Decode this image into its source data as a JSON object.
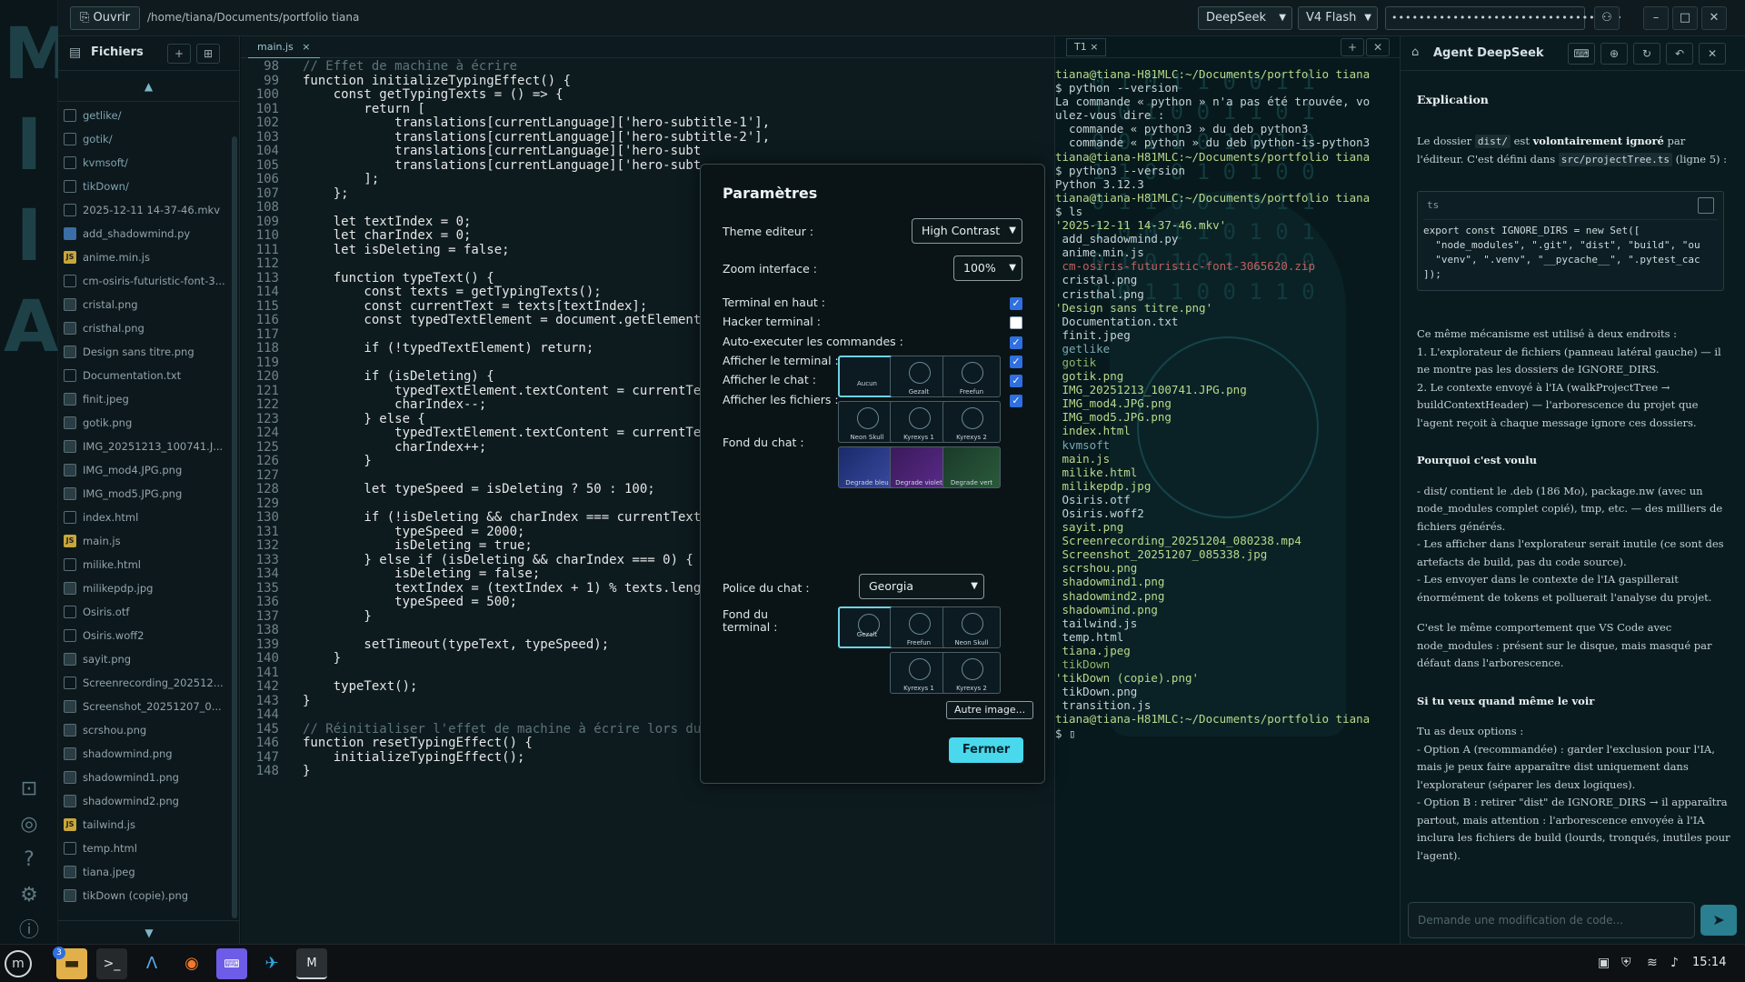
{
  "rail": {
    "letters": [
      "M",
      "I",
      "I",
      "A"
    ]
  },
  "topbar": {
    "open_label": "Ouvrir",
    "path": "/home/tiana/Documents/portfolio tiana",
    "provider": "DeepSeek",
    "model": "V4 Flash",
    "api_key_masked": "••••••••••••••••••••••••••••••••••"
  },
  "files": {
    "title": "Fichiers",
    "items": [
      {
        "name": "getlike/",
        "kind": "dir"
      },
      {
        "name": "gotik/",
        "kind": "dir"
      },
      {
        "name": "kvmsoft/",
        "kind": "dir"
      },
      {
        "name": "tikDown/",
        "kind": "dir"
      },
      {
        "name": "2025-12-11 14-37-46.mkv",
        "kind": "file"
      },
      {
        "name": "add_shadowmind.py",
        "kind": "py"
      },
      {
        "name": "anime.min.js",
        "kind": "js"
      },
      {
        "name": "cm-osiris-futuristic-font-3...",
        "kind": "file"
      },
      {
        "name": "cristal.png",
        "kind": "img"
      },
      {
        "name": "cristhal.png",
        "kind": "img"
      },
      {
        "name": "Design sans titre.png",
        "kind": "img"
      },
      {
        "name": "Documentation.txt",
        "kind": "file"
      },
      {
        "name": "finit.jpeg",
        "kind": "img"
      },
      {
        "name": "gotik.png",
        "kind": "img"
      },
      {
        "name": "IMG_20251213_100741.J...",
        "kind": "img"
      },
      {
        "name": "IMG_mod4.JPG.png",
        "kind": "img"
      },
      {
        "name": "IMG_mod5.JPG.png",
        "kind": "img"
      },
      {
        "name": "index.html",
        "kind": "file"
      },
      {
        "name": "main.js",
        "kind": "js"
      },
      {
        "name": "milike.html",
        "kind": "file"
      },
      {
        "name": "milikepdp.jpg",
        "kind": "img"
      },
      {
        "name": "Osiris.otf",
        "kind": "file"
      },
      {
        "name": "Osiris.woff2",
        "kind": "file"
      },
      {
        "name": "sayit.png",
        "kind": "img"
      },
      {
        "name": "Screenrecording_202512...",
        "kind": "file"
      },
      {
        "name": "Screenshot_20251207_0...",
        "kind": "img"
      },
      {
        "name": "scrshou.png",
        "kind": "img"
      },
      {
        "name": "shadowmind.png",
        "kind": "img"
      },
      {
        "name": "shadowmind1.png",
        "kind": "img"
      },
      {
        "name": "shadowmind2.png",
        "kind": "img"
      },
      {
        "name": "tailwind.js",
        "kind": "js"
      },
      {
        "name": "temp.html",
        "kind": "file"
      },
      {
        "name": "tiana.jpeg",
        "kind": "img"
      },
      {
        "name": "tikDown (copie).png",
        "kind": "img"
      }
    ]
  },
  "editor": {
    "tab": "main.js",
    "lines": [
      {
        "n": "98",
        "t": "// Effet de machine à écrire",
        "c": "cm"
      },
      {
        "n": "99",
        "t": "function initializeTypingEffect() {",
        "c": "fn"
      },
      {
        "n": "100",
        "t": "    const getTypingTexts = () => {",
        "c": "fn"
      },
      {
        "n": "101",
        "t": "        return [",
        "c": "fn"
      },
      {
        "n": "102",
        "t": "            translations[currentLanguage]['hero-subtitle-1'],",
        "c": "fn"
      },
      {
        "n": "103",
        "t": "            translations[currentLanguage]['hero-subtitle-2'],",
        "c": "fn"
      },
      {
        "n": "104",
        "t": "            translations[currentLanguage]['hero-subt",
        "c": "fn"
      },
      {
        "n": "105",
        "t": "            translations[currentLanguage]['hero-subt",
        "c": "fn"
      },
      {
        "n": "106",
        "t": "        ];",
        "c": "fn"
      },
      {
        "n": "107",
        "t": "    };",
        "c": "fn"
      },
      {
        "n": "108",
        "t": "",
        "c": "fn"
      },
      {
        "n": "109",
        "t": "    let textIndex = 0;",
        "c": "fn"
      },
      {
        "n": "110",
        "t": "    let charIndex = 0;",
        "c": "fn"
      },
      {
        "n": "111",
        "t": "    let isDeleting = false;",
        "c": "fn"
      },
      {
        "n": "112",
        "t": "",
        "c": "fn"
      },
      {
        "n": "113",
        "t": "    function typeText() {",
        "c": "fn"
      },
      {
        "n": "114",
        "t": "        const texts = getTypingTexts();",
        "c": "fn"
      },
      {
        "n": "115",
        "t": "        const currentText = texts[textIndex];",
        "c": "fn"
      },
      {
        "n": "116",
        "t": "        const typedTextElement = document.getElement",
        "c": "fn"
      },
      {
        "n": "117",
        "t": "",
        "c": "fn"
      },
      {
        "n": "118",
        "t": "        if (!typedTextElement) return;",
        "c": "fn"
      },
      {
        "n": "119",
        "t": "",
        "c": "fn"
      },
      {
        "n": "120",
        "t": "        if (isDeleting) {",
        "c": "fn"
      },
      {
        "n": "121",
        "t": "            typedTextElement.textContent = currentTe",
        "c": "fn"
      },
      {
        "n": "122",
        "t": "            charIndex--;",
        "c": "fn"
      },
      {
        "n": "123",
        "t": "        } else {",
        "c": "fn"
      },
      {
        "n": "124",
        "t": "            typedTextElement.textContent = currentTe",
        "c": "fn"
      },
      {
        "n": "125",
        "t": "            charIndex++;",
        "c": "fn"
      },
      {
        "n": "126",
        "t": "        }",
        "c": "fn"
      },
      {
        "n": "127",
        "t": "",
        "c": "fn"
      },
      {
        "n": "128",
        "t": "        let typeSpeed = isDeleting ? 50 : 100;",
        "c": "fn"
      },
      {
        "n": "129",
        "t": "",
        "c": "fn"
      },
      {
        "n": "130",
        "t": "        if (!isDeleting && charIndex === currentText",
        "c": "fn"
      },
      {
        "n": "131",
        "t": "            typeSpeed = 2000;",
        "c": "fn"
      },
      {
        "n": "132",
        "t": "            isDeleting = true;",
        "c": "fn"
      },
      {
        "n": "133",
        "t": "        } else if (isDeleting && charIndex === 0) {",
        "c": "fn"
      },
      {
        "n": "134",
        "t": "            isDeleting = false;",
        "c": "fn"
      },
      {
        "n": "135",
        "t": "            textIndex = (textIndex + 1) % texts.leng",
        "c": "fn"
      },
      {
        "n": "136",
        "t": "            typeSpeed = 500;",
        "c": "fn"
      },
      {
        "n": "137",
        "t": "        }",
        "c": "fn"
      },
      {
        "n": "138",
        "t": "",
        "c": "fn"
      },
      {
        "n": "139",
        "t": "        setTimeout(typeText, typeSpeed);",
        "c": "fn"
      },
      {
        "n": "140",
        "t": "    }",
        "c": "fn"
      },
      {
        "n": "141",
        "t": "",
        "c": "fn"
      },
      {
        "n": "142",
        "t": "    typeText();",
        "c": "fn"
      },
      {
        "n": "143",
        "t": "}",
        "c": "fn"
      },
      {
        "n": "144",
        "t": "",
        "c": "fn"
      },
      {
        "n": "145",
        "t": "// Réinitialiser l'effet de machine à écrire lors du changement de langue",
        "c": "cm"
      },
      {
        "n": "146",
        "t": "function resetTypingEffect() {",
        "c": "fn"
      },
      {
        "n": "147",
        "t": "    initializeTypingEffect();",
        "c": "fn"
      },
      {
        "n": "148",
        "t": "}",
        "c": "fn"
      }
    ]
  },
  "settings": {
    "title": "Paramètres",
    "theme_label": "Theme editeur :",
    "theme_value": "High Contrast",
    "zoom_label": "Zoom interface :",
    "zoom_value": "100%",
    "toggles": [
      {
        "label": "Terminal en haut :",
        "checked": true
      },
      {
        "label": "Hacker terminal :",
        "checked": false
      },
      {
        "label": "Auto-executer les commandes :",
        "checked": true
      },
      {
        "label": "Afficher le terminal :",
        "checked": true
      },
      {
        "label": "Afficher le chat :",
        "checked": true
      },
      {
        "label": "Afficher les fichiers :",
        "checked": true
      }
    ],
    "chat_bg_label": "Fond du chat :",
    "chat_bg_options": [
      "Aucun",
      "Gezalt",
      "Freefun",
      "Neon Skull",
      "Kyrexys 1",
      "Kyrexys 2",
      "Degrade bleu",
      "Degrade violet",
      "Degrade vert"
    ],
    "font_label": "Police du chat :",
    "font_value": "Georgia",
    "term_bg_label": "Fond du terminal :",
    "term_bg_options": [
      "Gezalt",
      "Freefun",
      "Neon Skull",
      "Kyrexys 1",
      "Kyrexys 2"
    ],
    "other_image": "Autre image...",
    "close": "Fermer"
  },
  "terminal": {
    "tab": "T1",
    "lines": [
      {
        "t": "tiana@tiana-H81MLC:~/Documents/portfolio tiana",
        "c": "tl1"
      },
      {
        "t": "$ python --version",
        "c": "tl0"
      },
      {
        "t": "La commande « python » n'a pas été trouvée, vo",
        "c": "tl0"
      },
      {
        "t": "ulez-vous dire :",
        "c": "tl0"
      },
      {
        "t": "  commande « python3 » du deb python3",
        "c": "tl0"
      },
      {
        "t": "  commande « python » du deb python-is-python3",
        "c": "tl0"
      },
      {
        "t": "tiana@tiana-H81MLC:~/Documents/portfolio tiana",
        "c": "tl1"
      },
      {
        "t": "$ python3 --version",
        "c": "tl0"
      },
      {
        "t": "Python 3.12.3",
        "c": "tl0"
      },
      {
        "t": "tiana@tiana-H81MLC:~/Documents/portfolio tiana",
        "c": "tl1"
      },
      {
        "t": "$ ls",
        "c": "tl0"
      },
      {
        "t": "'2025-12-11 14-37-46.mkv'",
        "c": "tl1"
      },
      {
        "t": " add_shadowmind.py",
        "c": "tl0"
      },
      {
        "t": " anime.min.js",
        "c": "tl0"
      },
      {
        "t": " cm-osiris-futuristic-font-3065620.zip",
        "c": "tl2"
      },
      {
        "t": " cristal.png",
        "c": "tl0"
      },
      {
        "t": " cristhal.png",
        "c": "tl0"
      },
      {
        "t": "'Design sans titre.png'",
        "c": "tl1"
      },
      {
        "t": " Documentation.txt",
        "c": "tl0"
      },
      {
        "t": " finit.jpeg",
        "c": "tl0"
      },
      {
        "t": " getlike",
        "c": "tl4"
      },
      {
        "t": " gotik",
        "c": "tl3"
      },
      {
        "t": " gotik.png",
        "c": "tl1"
      },
      {
        "t": " IMG_20251213_100741.JPG.png",
        "c": "tl1"
      },
      {
        "t": " IMG_mod4.JPG.png",
        "c": "tl1"
      },
      {
        "t": " IMG_mod5.JPG.png",
        "c": "tl1"
      },
      {
        "t": " index.html",
        "c": "tl1"
      },
      {
        "t": " kvmsoft",
        "c": "tl4"
      },
      {
        "t": " main.js",
        "c": "tl1"
      },
      {
        "t": " milike.html",
        "c": "tl1"
      },
      {
        "t": " milikepdp.jpg",
        "c": "tl1"
      },
      {
        "t": " Osiris.otf",
        "c": "tl0"
      },
      {
        "t": " Osiris.woff2",
        "c": "tl0"
      },
      {
        "t": " sayit.png",
        "c": "tl1"
      },
      {
        "t": " Screenrecording_20251204_080238.mp4",
        "c": "tl1"
      },
      {
        "t": " Screenshot_20251207_085338.jpg",
        "c": "tl1"
      },
      {
        "t": " scrshou.png",
        "c": "tl1"
      },
      {
        "t": " shadowmind1.png",
        "c": "tl1"
      },
      {
        "t": " shadowmind2.png",
        "c": "tl1"
      },
      {
        "t": " shadowmind.png",
        "c": "tl1"
      },
      {
        "t": " tailwind.js",
        "c": "tl0"
      },
      {
        "t": " temp.html",
        "c": "tl0"
      },
      {
        "t": " tiana.jpeg",
        "c": "tl1"
      },
      {
        "t": " tikDown",
        "c": "tl3"
      },
      {
        "t": "'tikDown (copie).png'",
        "c": "tl1"
      },
      {
        "t": " tikDown.png",
        "c": "tl0"
      },
      {
        "t": " transition.js",
        "c": "tl0"
      },
      {
        "t": "tiana@tiana-H81MLC:~/Documents/portfolio tiana",
        "c": "tl1"
      },
      {
        "t": "$ ▯",
        "c": "tl0"
      }
    ]
  },
  "chat": {
    "title": "Agent DeepSeek",
    "heading": "Explication",
    "p1a": "Le dossier ",
    "p1code1": "dist/",
    "p1b": " est ",
    "p1bold": "volontairement ignoré",
    "p1c": " par l'éditeur. C'est défini dans ",
    "p1code2": "src/projectTree.ts",
    "p1d": " (ligne 5) :",
    "code_lang": "ts",
    "code": "export const IGNORE_DIRS = new Set([\n  \"node_modules\", \".git\", \"dist\", \"build\", \"ou\n  \"venv\", \".venv\", \"__pycache__\", \".pytest_cac\n]);",
    "p2": "Ce même mécanisme est utilisé à deux endroits :",
    "p2bold": "deux endroits",
    "li1": "1. L'explorateur de fichiers (panneau latéral gauche) — il ne montre pas les dossiers de IGNORE_DIRS.",
    "li2": "2. Le contexte envoyé à l'IA (walkProjectTree → buildContextHeader) — l'arborescence du projet que l'agent reçoit à chaque message ignore ces dossiers.",
    "h2": "Pourquoi c'est voulu",
    "w1": "- dist/ contient le .deb (186 Mo), package.nw (avec un node_modules complet copié), tmp, etc. — des milliers de fichiers générés.",
    "w2": "- Les afficher dans l'explorateur serait inutile (ce sont des artefacts de build, pas du code source).",
    "w3": "- Les envoyer dans le contexte de l'IA gaspillerait énormément de tokens et polluerait l'analyse du projet.",
    "w4": "C'est le même comportement que VS Code avec node_modules : présent sur le disque, mais masqué par défaut dans l'arborescence.",
    "h3": "Si tu veux quand même le voir",
    "o0": "Tu as deux options :",
    "o1": "- Option A (recommandée) : garder l'exclusion pour l'IA, mais je peux faire apparaître dist uniquement dans l'explorateur (séparer les deux logiques).",
    "o2": "- Option B : retirer \"dist\" de IGNORE_DIRS → il apparaîtra partout, mais attention : l'arborescence envoyée à l'IA inclura les fichiers de build (lourds, tronqués, inutiles pour l'agent).",
    "input_placeholder": "Demande une modification de code..."
  },
  "taskbar": {
    "badge": "3",
    "clock": "15:14"
  }
}
